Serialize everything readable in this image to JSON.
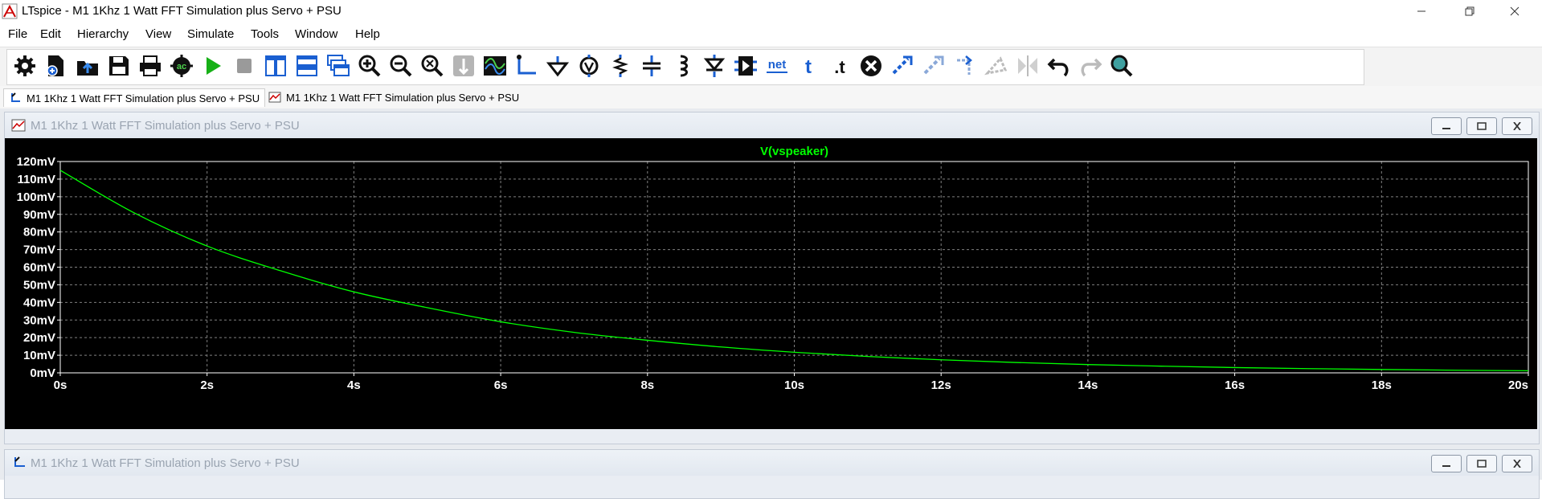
{
  "window": {
    "title": "LTspice - M1 1Khz 1 Watt FFT Simulation plus Servo + PSU"
  },
  "menu": [
    "File",
    "Edit",
    "Hierarchy",
    "View",
    "Simulate",
    "Tools",
    "Window",
    "Help"
  ],
  "toolbar": [
    {
      "name": "settings-icon"
    },
    {
      "name": "new-schematic-icon"
    },
    {
      "name": "open-file-icon"
    },
    {
      "name": "save-icon"
    },
    {
      "name": "print-icon"
    },
    {
      "name": "ac-analysis-icon"
    },
    {
      "name": "run-icon"
    },
    {
      "name": "halt-icon"
    },
    {
      "name": "tile-vertical-icon"
    },
    {
      "name": "tile-horizontal-icon"
    },
    {
      "name": "cascade-icon"
    },
    {
      "name": "zoom-in-icon"
    },
    {
      "name": "zoom-out-icon"
    },
    {
      "name": "zoom-fit-icon"
    },
    {
      "name": "autorange-icon"
    },
    {
      "name": "waveform-icon"
    },
    {
      "name": "wire-icon"
    },
    {
      "name": "ground-icon"
    },
    {
      "name": "voltage-source-icon"
    },
    {
      "name": "resistor-icon"
    },
    {
      "name": "capacitor-icon"
    },
    {
      "name": "inductor-icon"
    },
    {
      "name": "diode-icon"
    },
    {
      "name": "component-icon"
    },
    {
      "name": "net-label-icon",
      "text": "net"
    },
    {
      "name": "text-icon",
      "text": "t"
    },
    {
      "name": "spice-directive-icon",
      "text": ".t"
    },
    {
      "name": "delete-icon"
    },
    {
      "name": "move-icon"
    },
    {
      "name": "drag-icon"
    },
    {
      "name": "rotate-icon"
    },
    {
      "name": "mirror-icon"
    },
    {
      "name": "mirror-disabled-icon"
    },
    {
      "name": "undo-icon"
    },
    {
      "name": "redo-icon"
    },
    {
      "name": "find-icon"
    }
  ],
  "tabs": [
    {
      "label": "M1 1Khz 1 Watt FFT Simulation plus Servo + PSU",
      "type": "schematic",
      "active": true
    },
    {
      "label": "M1 1Khz 1 Watt FFT Simulation plus Servo + PSU",
      "type": "waveform",
      "active": false
    }
  ],
  "plot_window": {
    "title": "M1 1Khz 1 Watt FFT Simulation plus Servo + PSU"
  },
  "schematic_window": {
    "title": "M1 1Khz 1 Watt FFT Simulation plus Servo + PSU"
  },
  "chart_data": {
    "type": "line",
    "title": "V(vspeaker)",
    "series": [
      {
        "name": "V(vspeaker)",
        "color": "#00ff00",
        "x": [
          0,
          1,
          2,
          3,
          4,
          5,
          6,
          7,
          8,
          9,
          10,
          11,
          12,
          13,
          14,
          15,
          16,
          17,
          18,
          19,
          20
        ],
        "y": [
          115,
          91,
          72,
          58,
          46,
          37,
          29,
          23,
          18.5,
          14.7,
          11.7,
          9.3,
          7.4,
          5.9,
          4.7,
          3.8,
          3.0,
          2.4,
          1.9,
          1.5,
          1.2
        ]
      }
    ],
    "xticks": [
      "0s",
      "2s",
      "4s",
      "6s",
      "8s",
      "10s",
      "12s",
      "14s",
      "16s",
      "18s",
      "20s"
    ],
    "yticks": [
      "0mV",
      "10mV",
      "20mV",
      "30mV",
      "40mV",
      "50mV",
      "60mV",
      "70mV",
      "80mV",
      "90mV",
      "100mV",
      "110mV",
      "120mV"
    ],
    "xlim": [
      0,
      20
    ],
    "ylim": [
      0,
      120
    ],
    "grid": true,
    "background": "#000000",
    "axis_color": "#ffffff",
    "grid_color": "#808080"
  }
}
